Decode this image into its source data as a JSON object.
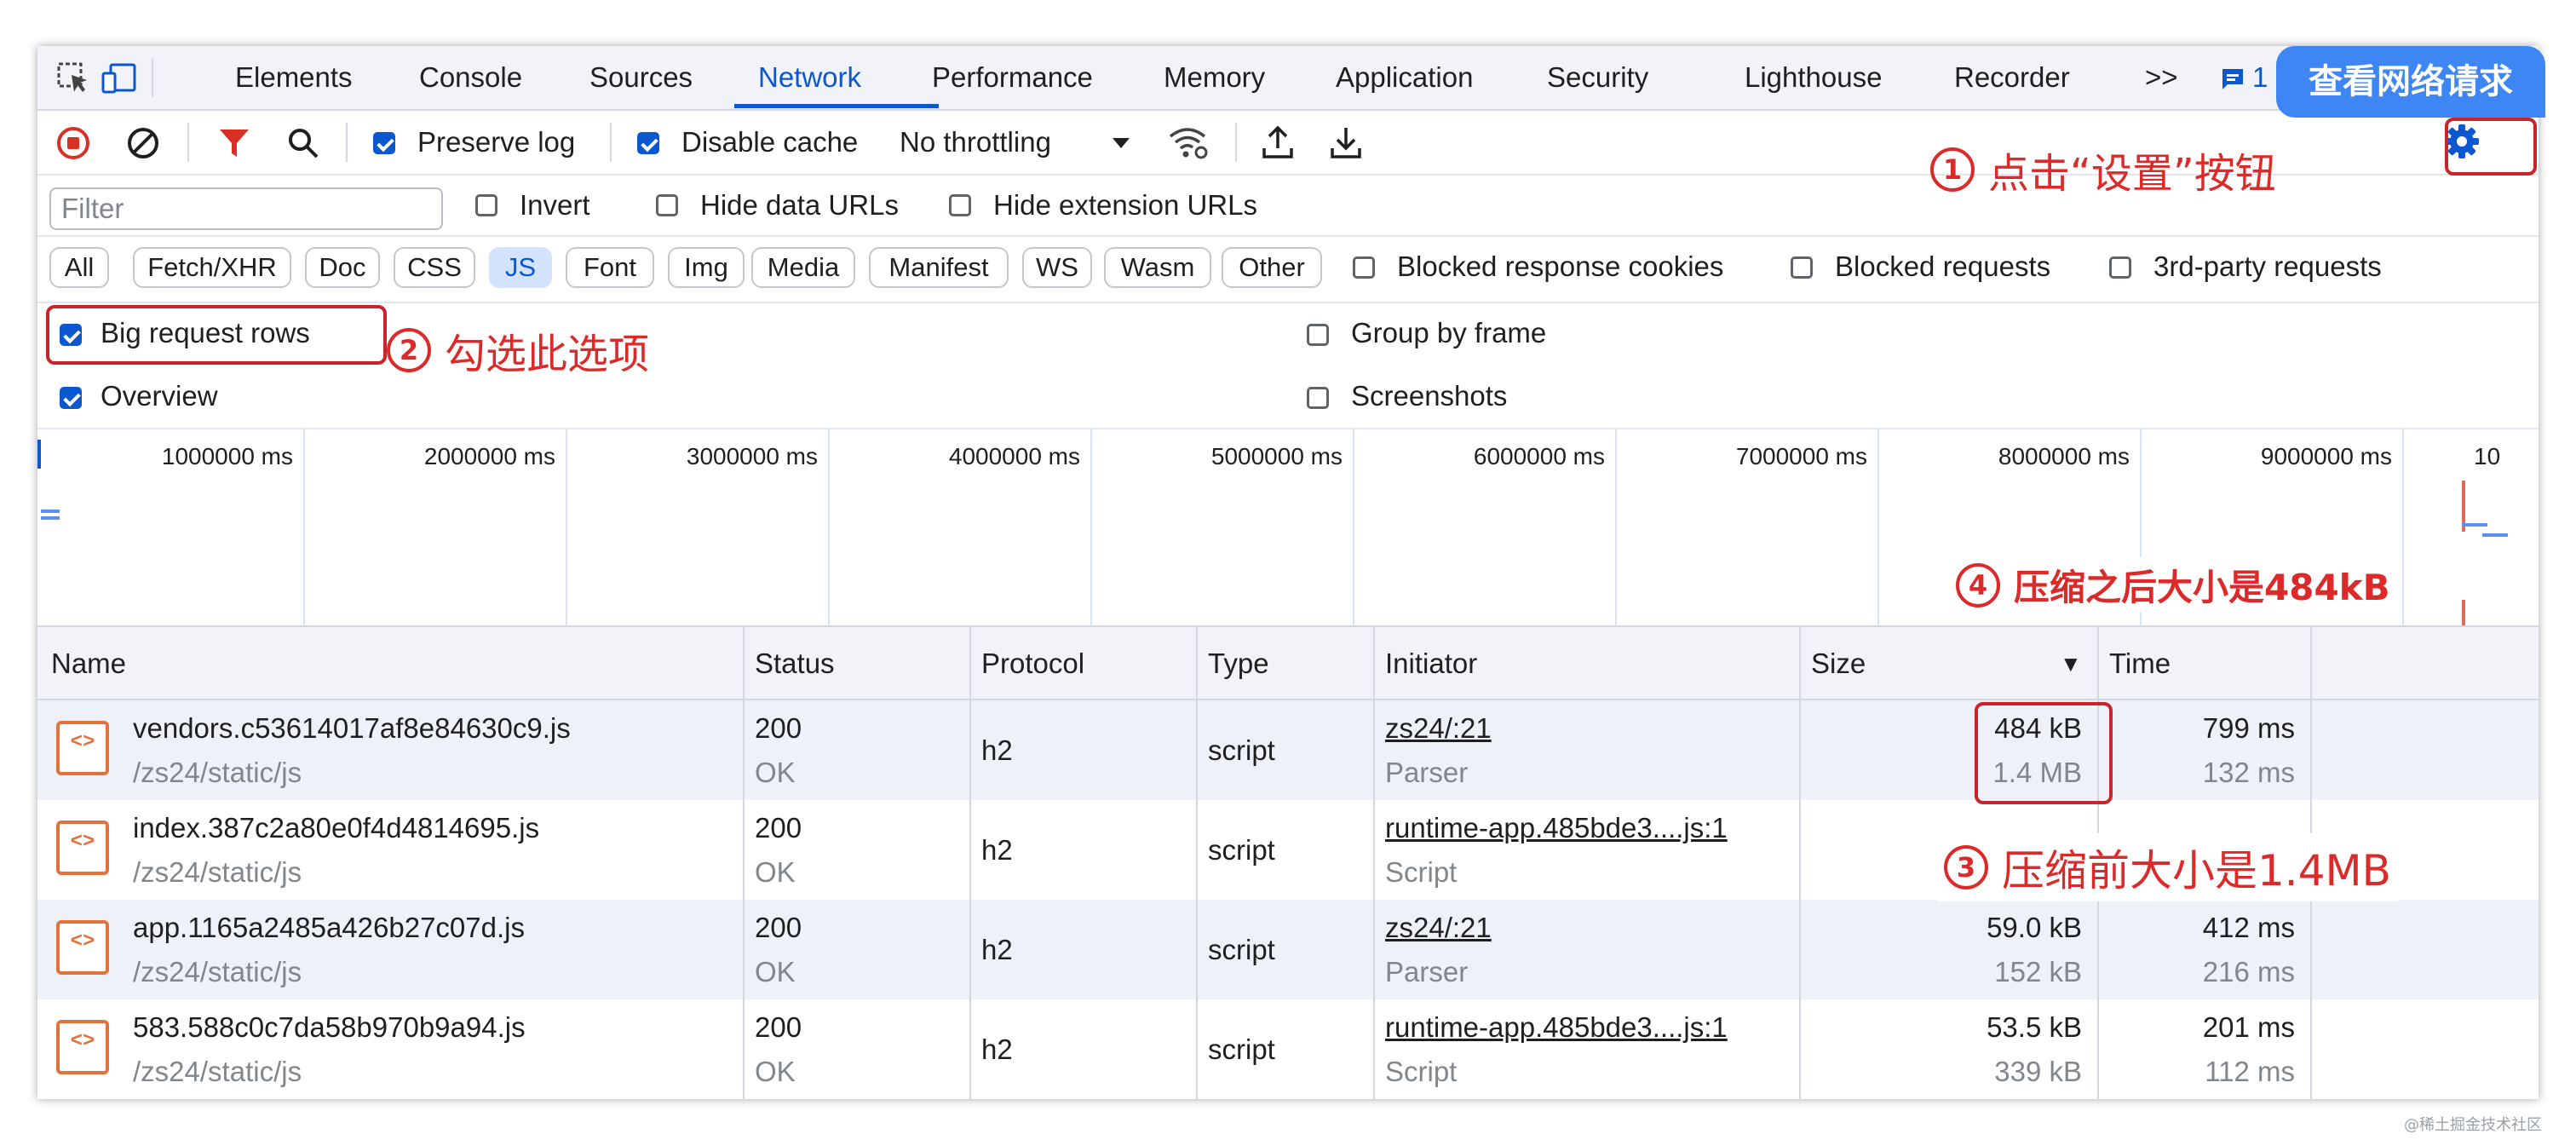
{
  "tabs": [
    "Elements",
    "Console",
    "Sources",
    "Network",
    "Performance",
    "Memory",
    "Application",
    "Security",
    "Lighthouse",
    "Recorder"
  ],
  "active_tab": "Network",
  "more_tabs": ">>",
  "issues_count": "1",
  "toolbar": {
    "preserve_log": "Preserve log",
    "disable_cache": "Disable cache",
    "throttling": "No throttling"
  },
  "filter": {
    "placeholder": "Filter",
    "invert": "Invert",
    "hide_data_urls": "Hide data URLs",
    "hide_extension_urls": "Hide extension URLs"
  },
  "type_filters": [
    "All",
    "Fetch/XHR",
    "Doc",
    "CSS",
    "JS",
    "Font",
    "Img",
    "Media",
    "Manifest",
    "WS",
    "Wasm",
    "Other"
  ],
  "type_filter_active": "JS",
  "blocked_filters": [
    "Blocked response cookies",
    "Blocked requests",
    "3rd-party requests"
  ],
  "settings_options": {
    "big_request_rows": "Big request rows",
    "overview": "Overview",
    "group_by_frame": "Group by frame",
    "screenshots": "Screenshots"
  },
  "timeline_labels": [
    "1000000 ms",
    "2000000 ms",
    "3000000 ms",
    "4000000 ms",
    "5000000 ms",
    "6000000 ms",
    "7000000 ms",
    "8000000 ms",
    "9000000 ms",
    "10"
  ],
  "columns": [
    "Name",
    "Status",
    "Protocol",
    "Type",
    "Initiator",
    "Size",
    "Time"
  ],
  "sort_indicator": "▼",
  "rows": [
    {
      "name": "vendors.c53614017af8e84630c9.js",
      "path": "/zs24/static/js",
      "status": "200",
      "status_text": "OK",
      "protocol": "h2",
      "type": "script",
      "initiator": "zs24/:21",
      "initiator_type": "Parser",
      "size": "484 kB",
      "size_res": "1.4 MB",
      "time": "799 ms",
      "latency": "132 ms"
    },
    {
      "name": "index.387c2a80e0f4d4814695.js",
      "path": "/zs24/static/js",
      "status": "200",
      "status_text": "OK",
      "protocol": "h2",
      "type": "script",
      "initiator": "runtime-app.485bde3....js:1",
      "initiator_type": "Script",
      "size": "",
      "size_res": "",
      "time": "",
      "latency": ""
    },
    {
      "name": "app.1165a2485a426b27c07d.js",
      "path": "/zs24/static/js",
      "status": "200",
      "status_text": "OK",
      "protocol": "h2",
      "type": "script",
      "initiator": "zs24/:21",
      "initiator_type": "Parser",
      "size": "59.0 kB",
      "size_res": "152 kB",
      "time": "412 ms",
      "latency": "216 ms"
    },
    {
      "name": "583.588c0c7da58b970b9a94.js",
      "path": "/zs24/static/js",
      "status": "200",
      "status_text": "OK",
      "protocol": "h2",
      "type": "script",
      "initiator": "runtime-app.485bde3....js:1",
      "initiator_type": "Script",
      "size": "53.5 kB",
      "size_res": "339 kB",
      "time": "201 ms",
      "latency": "112 ms"
    }
  ],
  "annotations": {
    "view_requests": "查看网络请求",
    "step1_num": "1",
    "step1": "点击“设置”按钮",
    "step2_num": "2",
    "step2": "勾选此选项",
    "step3_num": "3",
    "step3": "压缩前大小是1.4MB",
    "step4_num": "4",
    "step4": "压缩之后大小是484kB"
  },
  "watermark": "@稀土掘金技术社区",
  "colors": {
    "accent": "#0b57d0",
    "annotation_red": "#dc2a2a",
    "file_icon": "#e2723a",
    "callout_blue": "#3f86f5"
  }
}
